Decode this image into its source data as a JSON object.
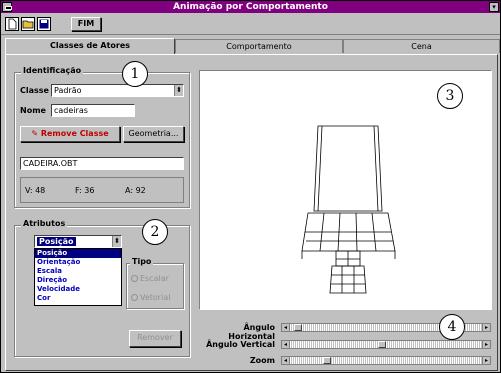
{
  "window": {
    "title": "Animação por Comportamento",
    "menu_arrow": "▾"
  },
  "toolbar": {
    "icons": [
      "new-icon",
      "open-icon",
      "save-icon"
    ],
    "fim_label": "FIM"
  },
  "tabs": [
    {
      "label": "Classes de Atores",
      "active": true
    },
    {
      "label": "Comportamento",
      "active": false
    },
    {
      "label": "Cena",
      "active": false
    }
  ],
  "identificacao": {
    "title": "Identificação",
    "classe_label": "Classe",
    "classe_value": "Padrão",
    "nome_label": "Nome",
    "nome_value": "cadeiras",
    "remove_label": "Remove Classe",
    "geometria_label": "Geometria...",
    "file_value": "CADEIRA.OBT",
    "stats": {
      "v_label": "V:",
      "v": "48",
      "f_label": "F:",
      "f": "36",
      "a_label": "A:",
      "a": "92"
    }
  },
  "atributos": {
    "title": "Atributos",
    "selected": "Posição",
    "options": [
      "Posição",
      "Orientação",
      "Escala",
      "Direção",
      "Velocidade",
      "Cor"
    ],
    "tipo_title": "Tipo",
    "escalar_label": "Escalar",
    "vetorial_label": "Vetorial",
    "remover_label": "Remover"
  },
  "sliders": [
    {
      "label": "Ângulo Horizontal",
      "value": 0.02
    },
    {
      "label": "Ângulo Vertical",
      "value": 0.48
    },
    {
      "label": "Zoom",
      "value": 0.18
    }
  ],
  "callouts": [
    "1",
    "2",
    "3",
    "4"
  ],
  "colors": {
    "titlebar": "#800080",
    "selection": "#000080",
    "remove_text": "#c00000"
  }
}
